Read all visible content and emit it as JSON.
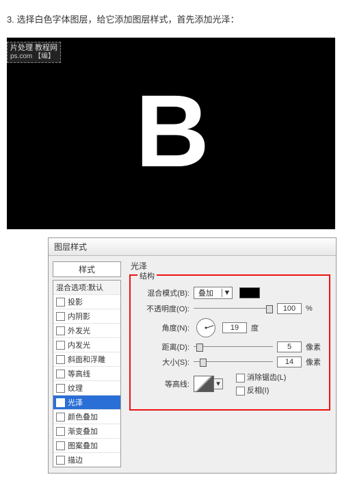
{
  "step_text": "3. 选择白色字体图层，给它添加图层样式，首先添加光泽：",
  "watermark": {
    "line1": "片处理 教程网",
    "line2": "ps.com  【编】"
  },
  "letter": "B",
  "dialog": {
    "title": "图层样式",
    "styles_header": "样式",
    "styles": [
      {
        "label": "混合选项:默认",
        "checked": false,
        "hasbox": false
      },
      {
        "label": "投影",
        "checked": false,
        "hasbox": true
      },
      {
        "label": "内阴影",
        "checked": false,
        "hasbox": true
      },
      {
        "label": "外发光",
        "checked": false,
        "hasbox": true
      },
      {
        "label": "内发光",
        "checked": false,
        "hasbox": true
      },
      {
        "label": "斜面和浮雕",
        "checked": false,
        "hasbox": true
      },
      {
        "label": "等高线",
        "checked": false,
        "hasbox": true
      },
      {
        "label": "纹理",
        "checked": false,
        "hasbox": true
      },
      {
        "label": "光泽",
        "checked": true,
        "hasbox": true,
        "selected": true
      },
      {
        "label": "颜色叠加",
        "checked": false,
        "hasbox": true
      },
      {
        "label": "渐变叠加",
        "checked": false,
        "hasbox": true
      },
      {
        "label": "图案叠加",
        "checked": false,
        "hasbox": true
      },
      {
        "label": "描边",
        "checked": false,
        "hasbox": true
      }
    ],
    "panel_name": "光泽",
    "group_name": "结构",
    "fields": {
      "blend_label": "混合模式(B):",
      "blend_value": "叠加",
      "opacity_label": "不透明度(O):",
      "opacity_value": "100",
      "opacity_unit": "%",
      "angle_label": "角度(N):",
      "angle_value": "19",
      "angle_unit": "度",
      "distance_label": "距离(D):",
      "distance_value": "5",
      "distance_unit": "像素",
      "size_label": "大小(S):",
      "size_value": "14",
      "size_unit": "像素",
      "contour_label": "等高线:",
      "antialias_label": "消除锯齿(L)",
      "invert_label": "反相(I)"
    }
  },
  "slider_pos": {
    "opacity": "96%",
    "distance": "8%",
    "size": "12%"
  }
}
